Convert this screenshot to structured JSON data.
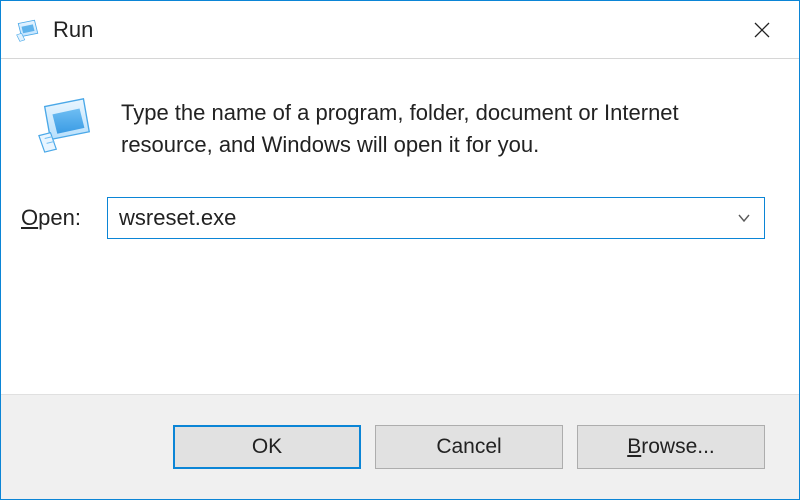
{
  "title": "Run",
  "description": "Type the name of a program, folder, document or Internet resource, and Windows will open it for you.",
  "open_label_prefix": "O",
  "open_label_rest": "pen:",
  "input_value": "wsreset.exe",
  "buttons": {
    "ok": "OK",
    "cancel": "Cancel",
    "browse_prefix": "B",
    "browse_rest": "rowse..."
  },
  "colors": {
    "accent": "#0b85d6"
  }
}
